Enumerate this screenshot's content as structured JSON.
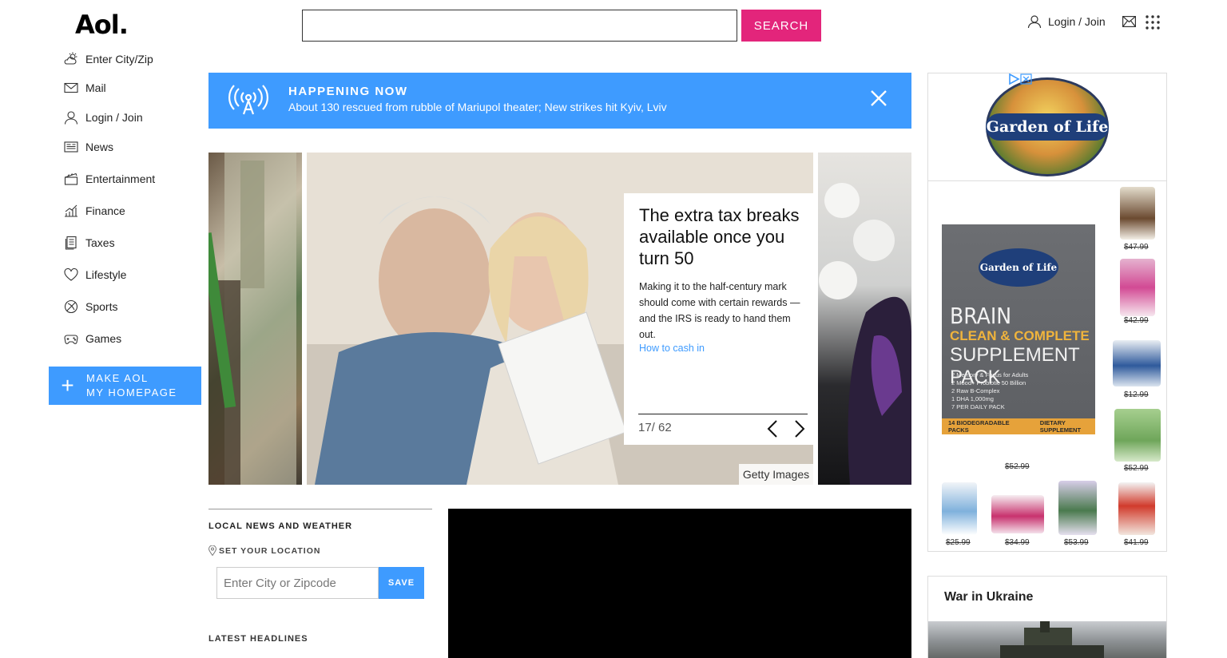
{
  "header": {
    "logo": "Aol.",
    "search_placeholder": "",
    "search_button": "SEARCH",
    "login_label": "Login / Join"
  },
  "sidebar": {
    "items": [
      {
        "label": "Enter City/Zip",
        "icon": "weather-icon"
      },
      {
        "label": "Mail",
        "icon": "mail-icon"
      },
      {
        "label": "Login / Join",
        "icon": "user-icon"
      },
      {
        "label": "News",
        "icon": "news-icon"
      },
      {
        "label": "Entertainment",
        "icon": "clapperboard-icon"
      },
      {
        "label": "Finance",
        "icon": "chart-icon"
      },
      {
        "label": "Taxes",
        "icon": "document-icon"
      },
      {
        "label": "Lifestyle",
        "icon": "heart-icon"
      },
      {
        "label": "Sports",
        "icon": "ball-icon"
      },
      {
        "label": "Games",
        "icon": "gamepad-icon"
      }
    ],
    "homepage_line1": "MAKE AOL",
    "homepage_line2": "MY HOMEPAGE"
  },
  "happening": {
    "label": "HAPPENING NOW",
    "headline": "About 130 rescued from rubble of Mariupol theater; New strikes hit Kyiv, Lviv"
  },
  "carousel": {
    "title": "The extra tax breaks available once you turn 50",
    "summary": "Making it to the half-century mark should come with certain rewards — and the IRS is ready to hand them out.",
    "link": "How to cash in",
    "counter": "17/ 62",
    "credit": "Getty Images"
  },
  "local": {
    "title": "LOCAL NEWS AND WEATHER",
    "set_location": "SET YOUR LOCATION",
    "input_placeholder": "Enter City or Zipcode",
    "save": "SAVE",
    "latest": "LATEST HEADLINES"
  },
  "ad": {
    "brand": "Garden of Life",
    "pack_line1": "BRAIN",
    "pack_line2": "CLEAN & COMPLETE",
    "pack_line3": "SUPPLEMENT PACK",
    "pack_bullets": [
      "2 Memory & Focus for Adults",
      "2 Mood+ Probiotic 50 Billion",
      "2 Raw B-Complex",
      "1 DHA 1,000mg",
      "7 PER DAILY PACK"
    ],
    "pack_strip_left": "14 BIODEGRADABLE PACKS",
    "pack_strip_right": "DIETARY SUPPLEMENT",
    "prices": [
      "$47.99",
      "$42.99",
      "$12.99",
      "$52.99",
      "$52.99",
      "$25.99",
      "$34.99",
      "$53.99",
      "$41.99"
    ]
  },
  "war": {
    "title": "War in Ukraine"
  },
  "colors": {
    "accent_blue": "#3e9bff",
    "search_pink": "#e3257b"
  }
}
